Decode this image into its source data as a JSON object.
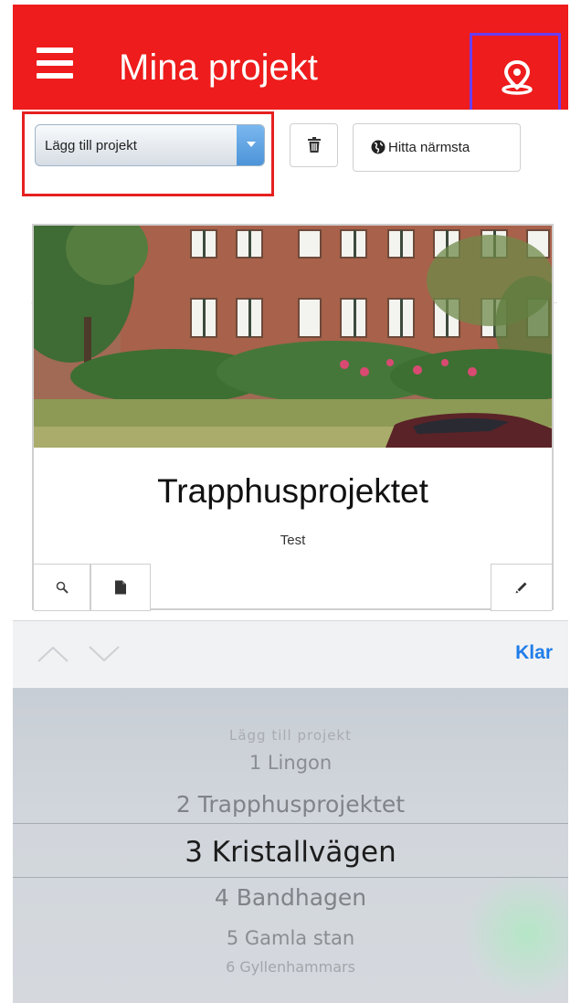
{
  "header": {
    "menu_icon": "hamburger-menu-icon",
    "title": "Mina projekt",
    "location_icon": "map-pin-icon",
    "color": "#ee1c1c",
    "highlight_color": "#6a3df2"
  },
  "toolbar": {
    "project_select": {
      "selected": "Lägg till projekt",
      "highlight_color": "#e62020"
    },
    "delete_icon": "trash-icon",
    "find_nearest": {
      "icon": "globe-icon",
      "label": "Hitta närmsta"
    }
  },
  "project_card": {
    "image_description": "Brick apartment building with garden and parked car",
    "title": "Trapphusprojektet",
    "subtitle": "Test",
    "actions": [
      "search-icon",
      "file-icon",
      "pencil-icon"
    ]
  },
  "picker": {
    "prev_icon": "chevron-up-icon",
    "next_icon": "chevron-down-icon",
    "done_label": "Klar",
    "done_color": "#1f7dea",
    "options": [
      "Lägg till projekt",
      "1 Lingon",
      "2 Trapphusprojektet",
      "3 Kristallvägen",
      "4 Bandhagen",
      "5 Gamla stan",
      "6 Gyllenhammars"
    ],
    "selected_index": 3
  }
}
